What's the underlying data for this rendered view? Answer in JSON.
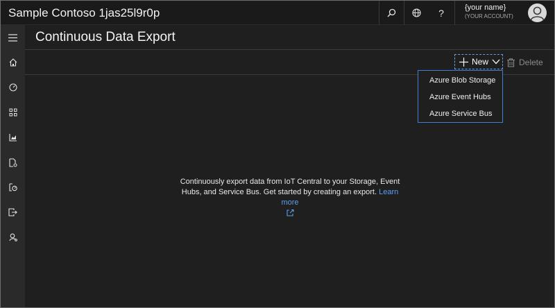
{
  "app": {
    "title": "Sample Contoso 1jas25l9r0p"
  },
  "topbar": {
    "search_icon": "search-icon",
    "globe_icon": "globe-icon",
    "help_label": "?",
    "account": {
      "name": "{your name}",
      "subtitle": "(YOUR ACCOUNT)"
    }
  },
  "rail": {
    "items": [
      "menu-icon",
      "home-icon",
      "dashboard-icon",
      "apps-icon",
      "analytics-icon",
      "device-templates-icon",
      "rules-icon",
      "export-icon",
      "administration-icon"
    ]
  },
  "page": {
    "title": "Continuous Data Export"
  },
  "toolbar": {
    "new_label": "New",
    "delete_label": "Delete"
  },
  "new_menu": {
    "items": [
      {
        "label": "Azure Blob Storage"
      },
      {
        "label": "Azure Event Hubs"
      },
      {
        "label": "Azure Service Bus"
      }
    ]
  },
  "empty_state": {
    "line1": "Continuously export data from IoT Central to your Storage, Event",
    "line2": "Hubs, and Service Bus. Get started by creating an export.",
    "link": "Learn more"
  },
  "colors": {
    "link": "#5aa0f0",
    "focus_border": "#3f7fd6",
    "background": "#1f1f1f"
  }
}
